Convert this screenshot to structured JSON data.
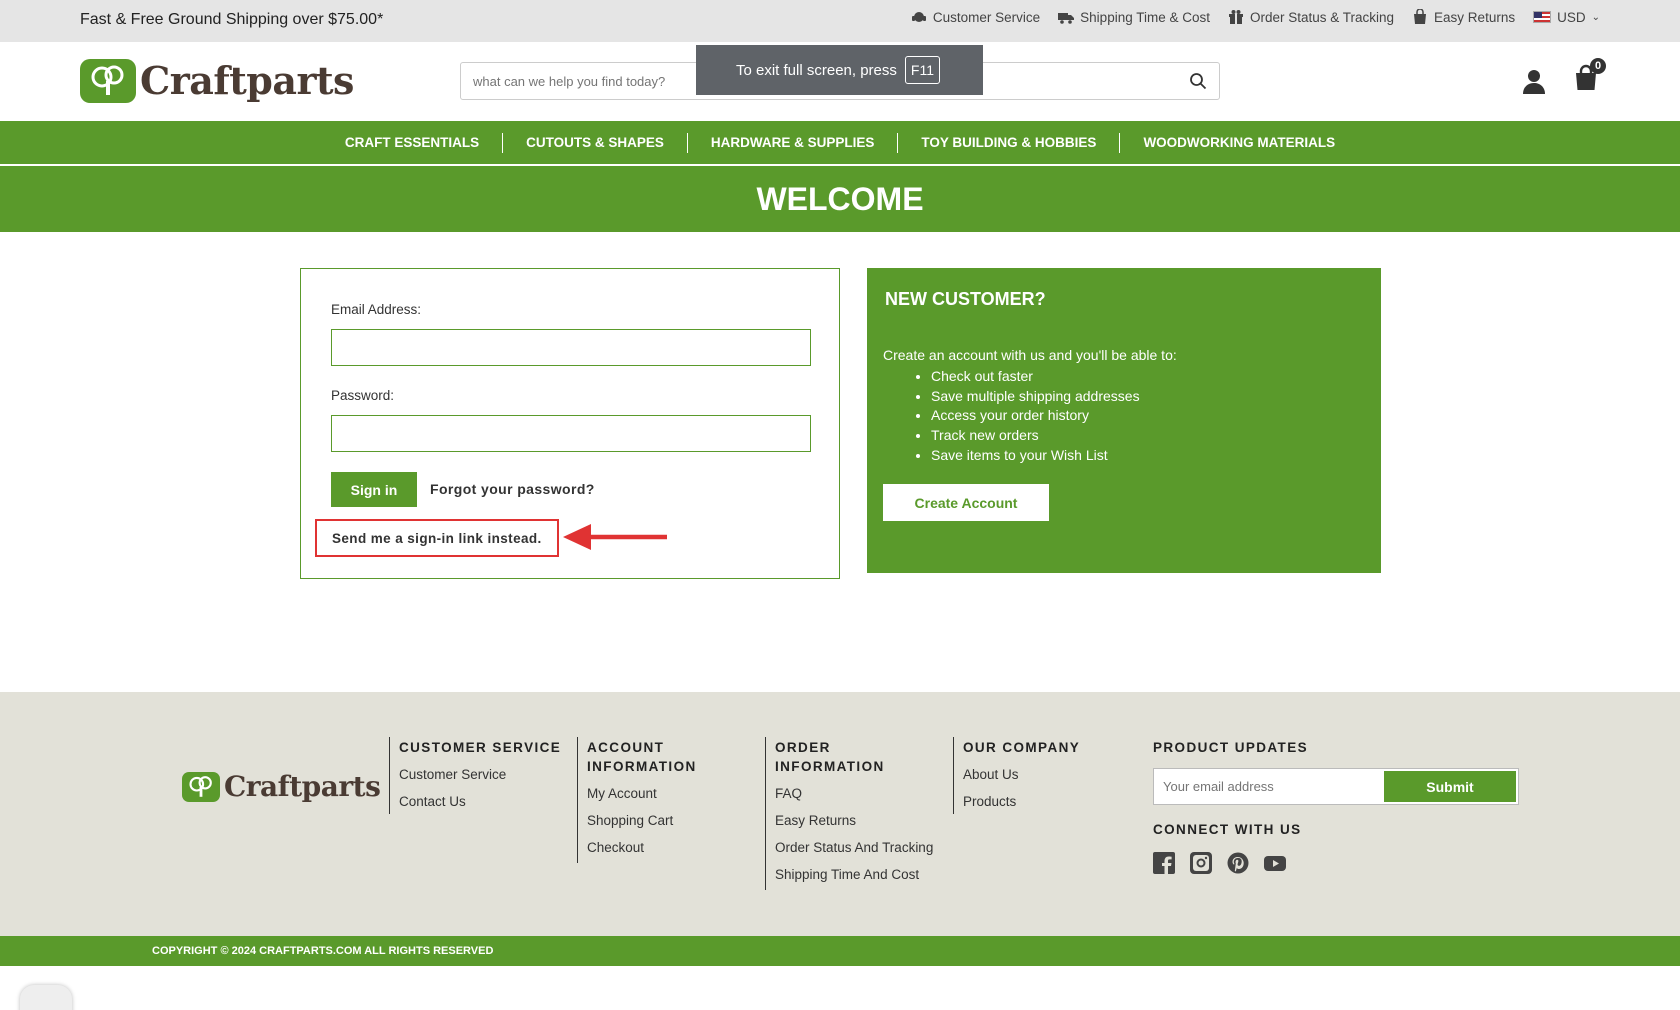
{
  "topbar": {
    "promo": "Fast & Free Ground Shipping over $75.00*",
    "links": [
      {
        "label": "Customer Service",
        "icon": "headset-icon"
      },
      {
        "label": "Shipping Time & Cost",
        "icon": "truck-icon"
      },
      {
        "label": "Order Status & Tracking",
        "icon": "gift-icon"
      },
      {
        "label": "Easy Returns",
        "icon": "return-bag-icon"
      }
    ],
    "currency": "USD"
  },
  "header": {
    "logo_text": "Craftparts",
    "search_placeholder": "what can we help you find today?",
    "cart_count": "0"
  },
  "fullscreen_toast": {
    "text": "To exit full screen, press",
    "key": "F11"
  },
  "nav": {
    "items": [
      "CRAFT ESSENTIALS",
      "CUTOUTS & SHAPES",
      "HARDWARE & SUPPLIES",
      "TOY BUILDING & HOBBIES",
      "WOODWORKING MATERIALS"
    ]
  },
  "page_title": "WELCOME",
  "login": {
    "email_label": "Email Address:",
    "password_label": "Password:",
    "signin_label": "Sign in",
    "forgot_label": "Forgot your password?",
    "signin_link_label": "Send me a sign-in link instead."
  },
  "new_customer": {
    "title": "NEW CUSTOMER?",
    "intro": "Create an account with us and you'll be able to:",
    "benefits": [
      "Check out faster",
      "Save multiple shipping addresses",
      "Access your order history",
      "Track new orders",
      "Save items to your Wish List"
    ],
    "create_label": "Create Account"
  },
  "footer": {
    "logo_text": "Craftparts",
    "columns": [
      {
        "title": "CUSTOMER SERVICE",
        "links": [
          "Customer Service",
          "Contact Us"
        ]
      },
      {
        "title": "ACCOUNT INFORMATION",
        "links": [
          "My Account",
          "Shopping Cart",
          "Checkout"
        ]
      },
      {
        "title": "ORDER INFORMATION",
        "links": [
          "FAQ",
          "Easy Returns",
          "Order Status And Tracking",
          "Shipping Time And Cost"
        ]
      },
      {
        "title": "OUR COMPANY",
        "links": [
          "About Us",
          "Products"
        ]
      }
    ],
    "updates_title": "PRODUCT UPDATES",
    "email_placeholder": "Your email address",
    "submit_label": "Submit",
    "connect_title": "CONNECT WITH US",
    "socials": [
      "facebook-icon",
      "instagram-icon",
      "pinterest-icon",
      "youtube-icon"
    ]
  },
  "copyright": "COPYRIGHT © 2024 CRAFTPARTS.COM ALL RIGHTS RESERVED",
  "colors": {
    "brand_green": "#5a9a2b",
    "annotation_red": "#e03333"
  }
}
